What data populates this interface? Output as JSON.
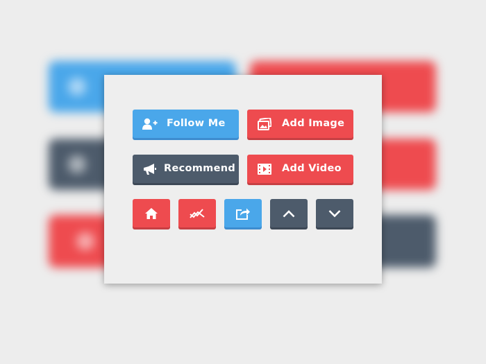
{
  "buttons": {
    "follow_me": "Follow Me",
    "add_image": "Add Image",
    "recommend": "Recommend",
    "add_video": "Add Video"
  },
  "icons": {
    "follow_me": "add-user-icon",
    "add_image": "image-icon",
    "recommend": "megaphone-icon",
    "add_video": "film-icon",
    "home": "home-icon",
    "trend": "trend-icon",
    "share": "share-icon",
    "up": "chevron-up-icon",
    "down": "chevron-down-icon"
  },
  "colors": {
    "blue": "#4aa7ea",
    "red": "#ee4b4f",
    "slate": "#4d5b6b",
    "card": "#eeeeee",
    "page": "#ededed"
  }
}
